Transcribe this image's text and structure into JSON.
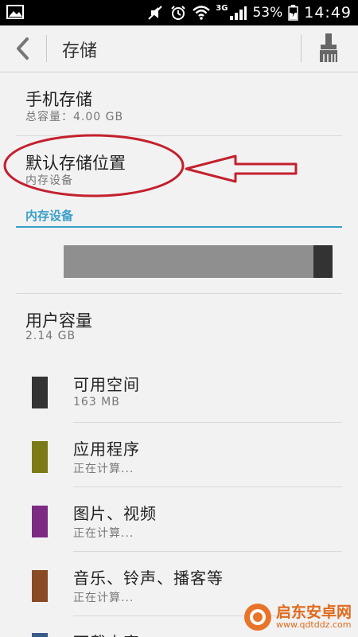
{
  "status_bar": {
    "network": "3G",
    "battery": "53%",
    "time": "14:49"
  },
  "app_bar": {
    "title": "存储"
  },
  "phone_storage": {
    "title": "手机存储",
    "subtitle": "总容量：4.00  GB"
  },
  "default_location": {
    "title": "默认存储位置",
    "subtitle": "内存设备"
  },
  "internal_section": {
    "header": "内存设备",
    "used_fraction": 0.93
  },
  "user_capacity": {
    "title": "用户容量",
    "subtitle": "2.14  GB"
  },
  "legend": [
    {
      "label": "可用空间",
      "value": "163  MB",
      "color": "#333333"
    },
    {
      "label": "应用程序",
      "value": "正在计算...",
      "color": "#7b7a17"
    },
    {
      "label": "图片、视频",
      "value": "正在计算...",
      "color": "#7d2a84"
    },
    {
      "label": "音乐、铃声、播客等",
      "value": "正在计算...",
      "color": "#8a4a24"
    }
  ],
  "partial_item": {
    "label": "下载内容",
    "color": "#3a5a8a"
  },
  "annotation_color": "#c4202e",
  "watermark": {
    "name": "启东安卓网",
    "url": "www.qdtddz.com"
  }
}
